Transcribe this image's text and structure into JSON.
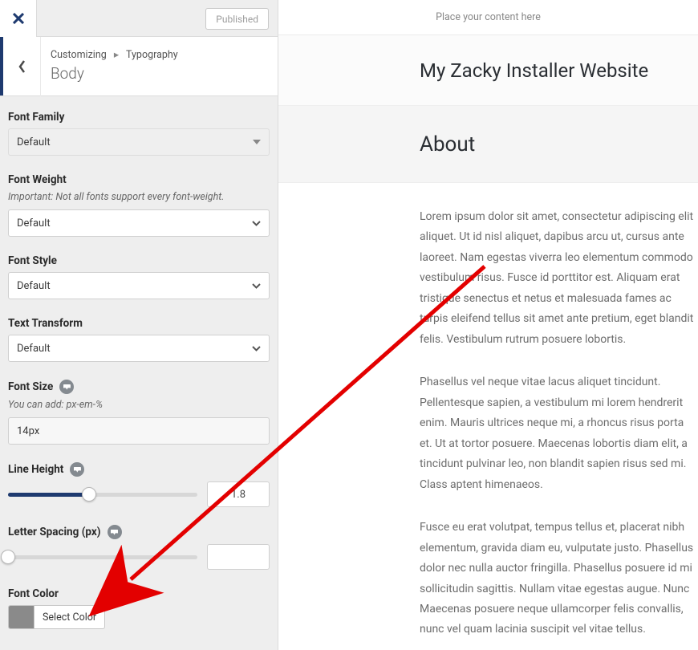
{
  "topbar": {
    "publish_label": "Published"
  },
  "crumb": {
    "a": "Customizing",
    "b": "Typography",
    "section": "Body"
  },
  "font_family": {
    "label": "Font Family",
    "value": "Default"
  },
  "font_weight": {
    "label": "Font Weight",
    "hint": "Important: Not all fonts support every font-weight.",
    "value": "Default"
  },
  "font_style": {
    "label": "Font Style",
    "value": "Default"
  },
  "text_transform": {
    "label": "Text Transform",
    "value": "Default"
  },
  "font_size": {
    "label": "Font Size",
    "hint": "You can add: px-em-%",
    "value": "14px"
  },
  "line_height": {
    "label": "Line Height",
    "value": "1.8",
    "pct": 43
  },
  "letter_spacing": {
    "label": "Letter Spacing (px)",
    "value": "",
    "pct": 0
  },
  "font_color": {
    "label": "Font Color",
    "button": "Select Color",
    "swatch": "#8a8a8a"
  },
  "preview": {
    "notice": "Place your content here",
    "site_title": "My Zacky Installer Website",
    "page_title": "About",
    "p1": "Lorem ipsum dolor sit amet, consectetur adipiscing elit aliquet. Ut id nisl aliquet, dapibus arcu ut, cursus ante laoreet. Nam egestas viverra leo elementum commodo vestibulum risus. Fusce id porttitor est. Aliquam erat tristique senectus et netus et malesuada fames ac turpis eleifend tellus sit amet ante pretium, eget blandit felis. Vestibulum rutrum posuere lobortis.",
    "p2": "Phasellus vel neque vitae lacus aliquet tincidunt. Pellentesque sapien, a vestibulum mi lorem hendrerit enim. Mauris ultrices neque mi, a rhoncus risus porta et. Ut at tortor posuere. Maecenas lobortis diam elit, a tincidunt pulvinar leo, non blandit sapien risus sed mi. Class aptent himenaeos.",
    "p3": "Fusce eu erat volutpat, tempus tellus et, placerat nibh elementum, gravida diam eu, vulputate justo. Phasellus dolor nec nulla auctor fringilla. Phasellus posuere id mi sollicitudin sagittis. Nullam vitae egestas augue. Nunc Maecenas posuere neque ullamcorper felis convallis, nunc vel quam lacinia suscipit vel vitae tellus."
  }
}
